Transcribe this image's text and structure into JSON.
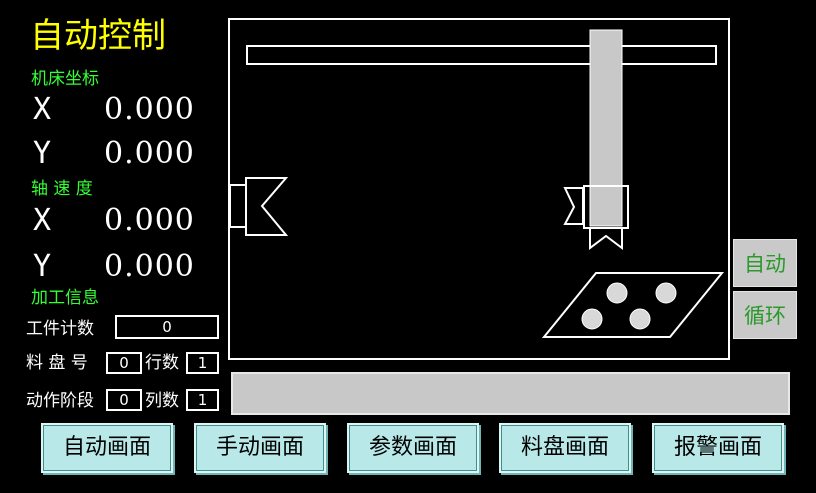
{
  "header": {
    "title": "自动控制"
  },
  "machine_coords": {
    "section_label": "机床坐标",
    "x_label": "X",
    "x_value": "0.000",
    "y_label": "Y",
    "y_value": "0.000"
  },
  "axis_speed": {
    "section_label": "轴 速 度",
    "x_label": "X",
    "x_value": "0.000",
    "y_label": "Y",
    "y_value": "0.000"
  },
  "processing_info": {
    "section_label": "加工信息",
    "workpiece_count_label": "工件计数",
    "workpiece_count_value": "0",
    "tray_number_label": "料 盘 号",
    "tray_number_value": "0",
    "rows_label": "行数",
    "rows_value": "1",
    "action_stage_label": "动作阶段",
    "action_stage_value": "0",
    "cols_label": "列数",
    "cols_value": "1"
  },
  "mode": {
    "auto_label": "自动",
    "cycle_label": "循环"
  },
  "status_bar": {
    "text": ""
  },
  "nav": {
    "auto_screen": "自动画面",
    "manual_screen": "手动画面",
    "params_screen": "参数画面",
    "tray_screen": "料盘画面",
    "alarm_screen": "报警画面"
  },
  "colors": {
    "title": "#ffff00",
    "section": "#33ff33",
    "mode_text": "#2a9a2a",
    "mode_bg": "#c9c9c9",
    "nav_bg": "#b8e8e8",
    "background": "#000000"
  }
}
